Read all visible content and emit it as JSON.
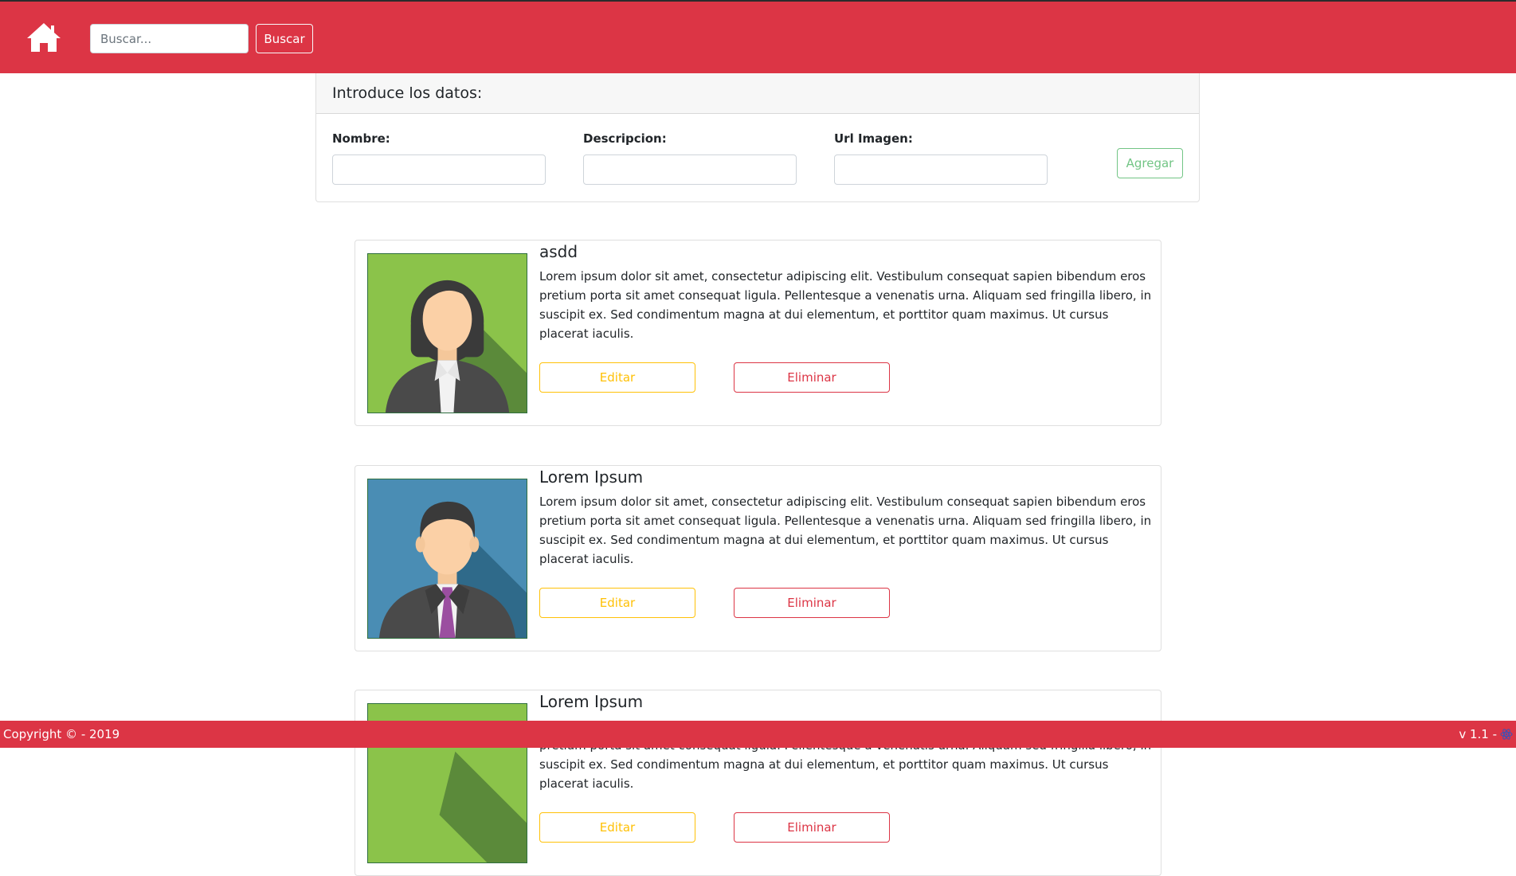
{
  "colors": {
    "primary": "#dc3545",
    "success": "#28a745",
    "warning": "#ffc107"
  },
  "navbar": {
    "home_icon": "home-icon",
    "search_placeholder": "Buscar...",
    "search_button": "Buscar"
  },
  "form": {
    "title": "Introduce los datos:",
    "fields": [
      {
        "label": "Nombre:",
        "value": ""
      },
      {
        "label": "Descripcion:",
        "value": ""
      },
      {
        "label": "Url Imagen:",
        "value": ""
      }
    ],
    "add_button": "Agregar"
  },
  "items": [
    {
      "name": "asdd",
      "description": "Lorem ipsum dolor sit amet, consectetur adipiscing elit. Vestibulum consequat sapien bibendum eros pretium porta sit amet consequat ligula. Pellentesque a venenatis urna. Aliquam sed fringilla libero, in suscipit ex. Sed condimentum magna at dui elementum, et porttitor quam maximus. Ut cursus placerat iaculis.",
      "avatar": "female-avatar",
      "edit_label": "Editar",
      "delete_label": "Eliminar"
    },
    {
      "name": "Lorem Ipsum",
      "description": "Lorem ipsum dolor sit amet, consectetur adipiscing elit. Vestibulum consequat sapien bibendum eros pretium porta sit amet consequat ligula. Pellentesque a venenatis urna. Aliquam sed fringilla libero, in suscipit ex. Sed condimentum magna at dui elementum, et porttitor quam maximus. Ut cursus placerat iaculis.",
      "avatar": "male-avatar",
      "edit_label": "Editar",
      "delete_label": "Eliminar"
    },
    {
      "name": "Lorem Ipsum",
      "description": "Lorem ipsum dolor sit amet, consectetur adipiscing elit. Vestibulum consequat sapien bibendum eros pretium porta sit amet consequat ligula. Pellentesque a venenatis urna. Aliquam sed fringilla libero, in suscipit ex. Sed condimentum magna at dui elementum, et porttitor quam maximus. Ut cursus placerat iaculis.",
      "avatar": "female-avatar",
      "edit_label": "Editar",
      "delete_label": "Eliminar"
    }
  ],
  "footer": {
    "copyright": "Copyright © - 2019",
    "version": "v 1.1 -",
    "version_icon": "react-icon"
  }
}
